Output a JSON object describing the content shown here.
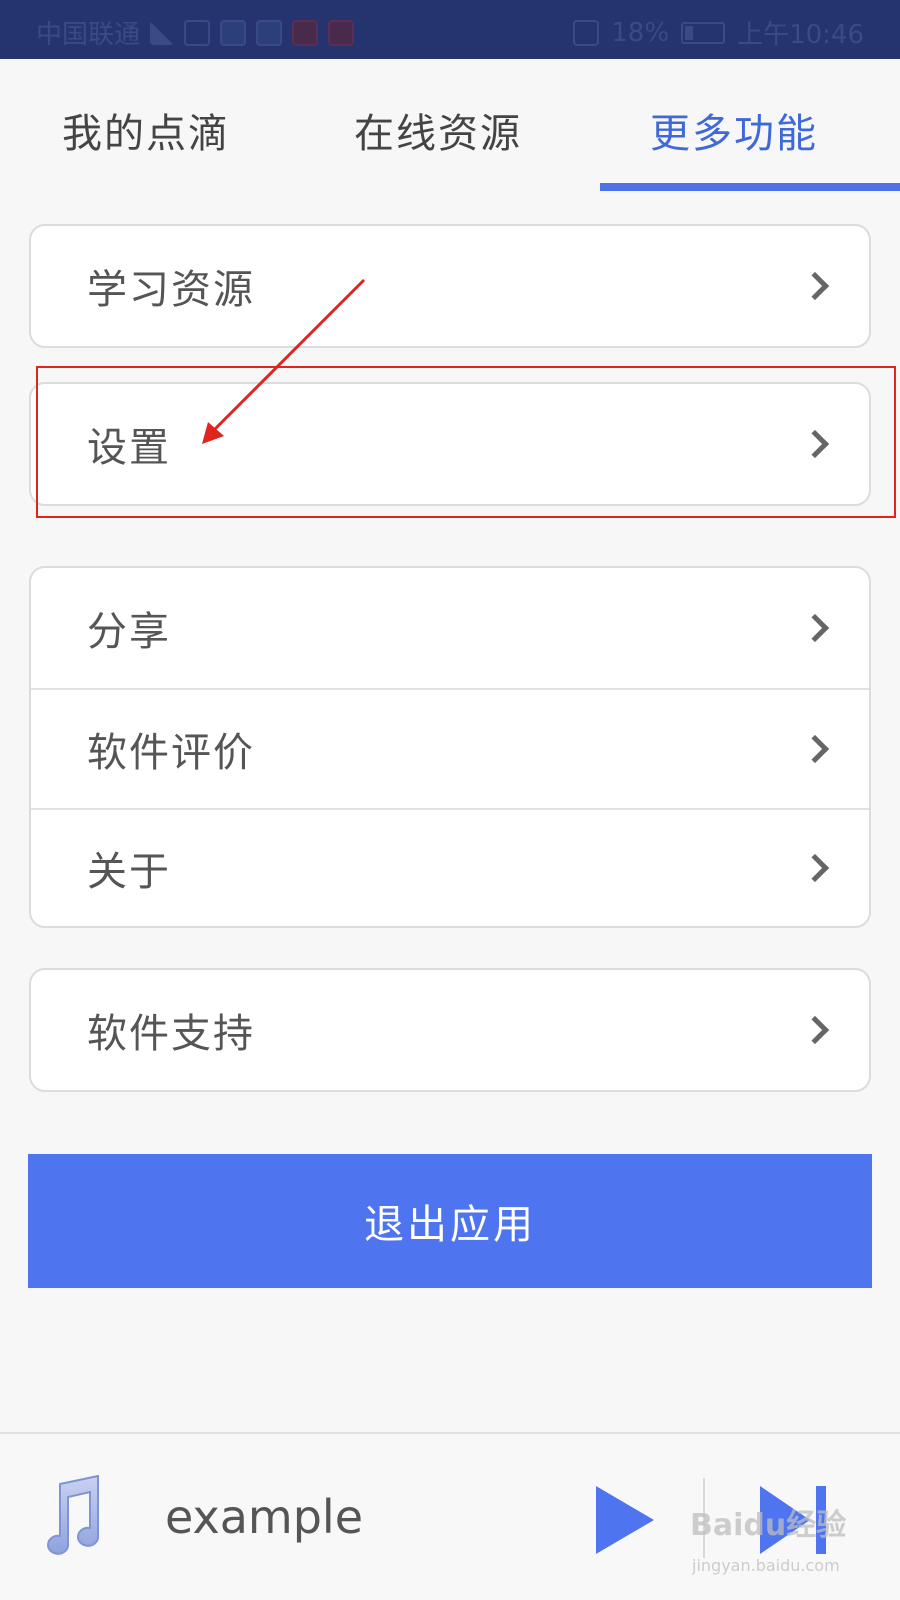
{
  "status_bar": {
    "carrier": "中国联通",
    "battery": "18%",
    "time": "上午10:46"
  },
  "tabs": [
    {
      "label": "我的点滴",
      "active": false
    },
    {
      "label": "在线资源",
      "active": false
    },
    {
      "label": "更多功能",
      "active": true
    }
  ],
  "groups": {
    "learning": {
      "items": [
        "学习资源"
      ]
    },
    "settings": {
      "items": [
        "设置"
      ]
    },
    "info": {
      "items": [
        "分享",
        "软件评价",
        "关于"
      ]
    },
    "support": {
      "items": [
        "软件支持"
      ]
    }
  },
  "exit_button": {
    "label": "退出应用"
  },
  "player": {
    "track_title": "example"
  },
  "watermark": {
    "text": "Baidu经验",
    "sub": "jingyan.baidu.com"
  },
  "colors": {
    "accent": "#4f74f0",
    "status_bar": "#25336f",
    "annotation": "#e0241e"
  },
  "icons": [
    "music-note-icon",
    "play-icon",
    "next-track-icon",
    "chevron-right-icon"
  ]
}
